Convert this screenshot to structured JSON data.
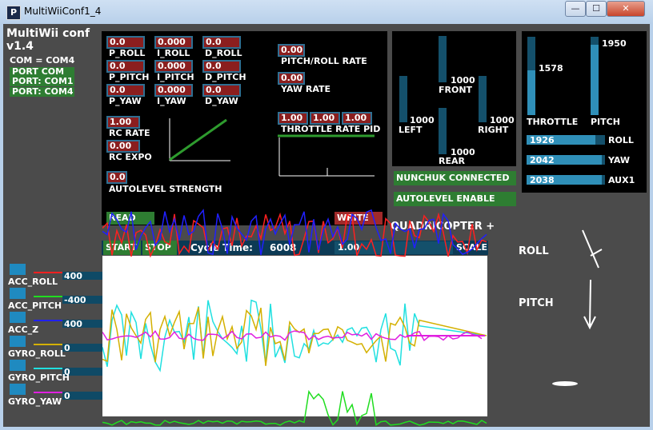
{
  "window": {
    "title": "MultiWiiConf1_4",
    "icon": "P",
    "min": "—",
    "max": "☐",
    "close": "✕"
  },
  "app": {
    "name": "MultiWii conf",
    "version": "v1.4",
    "com": "COM = COM4"
  },
  "ports": {
    "header": "PORT COM",
    "items": [
      "PORT: COM1",
      "PORT: COM4"
    ]
  },
  "pid": {
    "p_roll": "0.0",
    "i_roll": "0.000",
    "d_roll": "0.0",
    "p_pitch": "0.0",
    "i_pitch": "0.000",
    "d_pitch": "0.0",
    "p_yaw": "0.0",
    "i_yaw": "0.000",
    "d_yaw": "0.0",
    "labels": {
      "p_roll": "P_ROLL",
      "i_roll": "I_ROLL",
      "d_roll": "D_ROLL",
      "p_pitch": "P_PITCH",
      "i_pitch": "I_PITCH",
      "d_pitch": "D_PITCH",
      "p_yaw": "P_YAW",
      "i_yaw": "I_YAW",
      "d_yaw": "D_YAW"
    },
    "pitch_roll_rate": "0.00",
    "pitch_roll_rate_label": "PITCH/ROLL RATE",
    "yaw_rate": "0.00",
    "yaw_rate_label": "YAW RATE",
    "rc_rate": "1.00",
    "rc_rate_label": "RC RATE",
    "rc_expo": "0.00",
    "rc_expo_label": "RC EXPO",
    "autolevel": "0.0",
    "autolevel_label": "AUTOLEVEL STRENGTH",
    "throttle_pid": [
      "1.00",
      "1.00",
      "1.00"
    ],
    "throttle_pid_label": "THROTTLE RATE PID",
    "read": "READ",
    "write": "WRITE"
  },
  "motors": {
    "front": {
      "label": "FRONT",
      "value": "1000"
    },
    "left": {
      "label": "LEFT",
      "value": "1000"
    },
    "right": {
      "label": "RIGHT",
      "value": "1000"
    },
    "rear": {
      "label": "REAR",
      "value": "1000"
    }
  },
  "status": {
    "nunchuk": "NUNCHUK CONNECTED",
    "autolevel": "AUTOLEVEL ENABLE"
  },
  "rc": {
    "throttle": {
      "label": "THROTTLE",
      "value": "1578"
    },
    "pitch": {
      "label": "PITCH",
      "value": "1950"
    },
    "roll": {
      "label": "ROLL",
      "value": "1926"
    },
    "yaw": {
      "label": "YAW",
      "value": "2042"
    },
    "aux1": {
      "label": "AUX1",
      "value": "2038"
    }
  },
  "graph_ctrl": {
    "start": "START",
    "stop": "STOP",
    "cycle_label": "Cycle Time:",
    "cycle": "6008",
    "scale_value": "1.00",
    "scale": "SCALE",
    "mode": "QUADRICOPTER +"
  },
  "series": [
    {
      "name": "ACC_ROLL",
      "value": "400",
      "color": "#ff2020"
    },
    {
      "name": "ACC_PITCH",
      "value": "-400",
      "color": "#20dd20"
    },
    {
      "name": "ACC_Z",
      "value": "400",
      "color": "#2020ff"
    },
    {
      "name": "GYRO_ROLL",
      "value": "0",
      "color": "#d4b000"
    },
    {
      "name": "GYRO_PITCH",
      "value": "0",
      "color": "#20e0e0"
    },
    {
      "name": "GYRO_YAW",
      "value": "0",
      "color": "#e020e0"
    }
  ],
  "attitude": {
    "roll": "ROLL",
    "pitch": "PITCH"
  }
}
